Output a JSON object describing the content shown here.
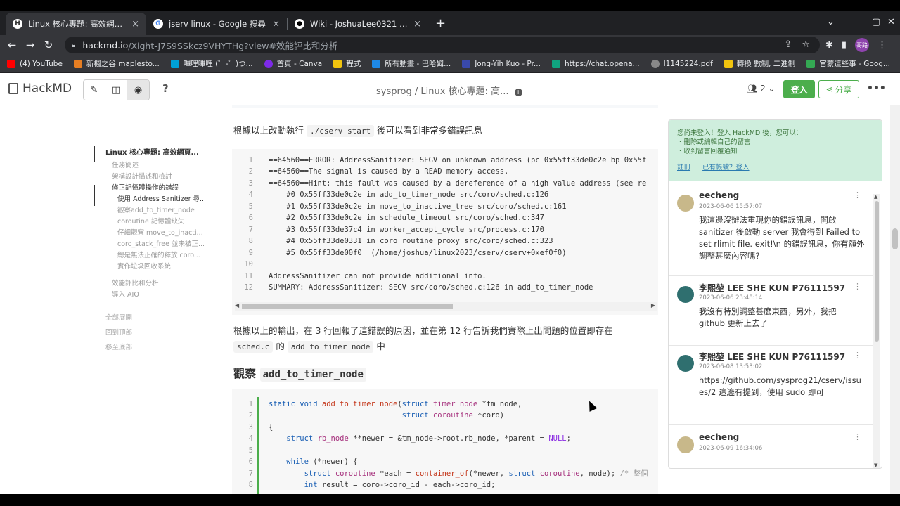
{
  "browser": {
    "tabs": [
      {
        "label": "Linux 核心專題: 高效網頁伺服器",
        "active": true,
        "favicon": "hackmd-icon"
      },
      {
        "label": "jserv linux - Google 搜尋",
        "active": false,
        "favicon": "google-icon"
      },
      {
        "label": "Wiki - JoshuaLee0321 (李熙堃)",
        "active": false,
        "favicon": "github-icon"
      }
    ],
    "new_tab": "+",
    "url_host": "hackmd.io",
    "url_path": "/Xight-J7S9SSkcz9VHYTHg?view#效能評比和分析",
    "profile": "哥路"
  },
  "bookmarks": [
    {
      "label": "(4) YouTube",
      "color": "#ff0000"
    },
    {
      "label": "新楓之谷 maplesto...",
      "color": "#e67e22"
    },
    {
      "label": "嗶哩嗶哩 (゜-゜)つ...",
      "color": "#00a1d6"
    },
    {
      "label": "首頁 - Canva",
      "color": "#7d2ae8"
    },
    {
      "label": "程式",
      "color": "#f1c40f"
    },
    {
      "label": "所有動畫 - 巴哈姆...",
      "color": "#1e88e5"
    },
    {
      "label": "Jong-Yih Kuo - Pr...",
      "color": "#3949ab"
    },
    {
      "label": "https://chat.opena...",
      "color": "#10a37f"
    },
    {
      "label": "I1145224.pdf",
      "color": "#888888"
    },
    {
      "label": "轉換 數制, 二進制",
      "color": "#f1c40f"
    },
    {
      "label": "官蒙這些事 - Goog...",
      "color": "#34a853"
    }
  ],
  "header": {
    "logo": "HackMD",
    "help": "?",
    "doc_title": "sysprog / Linux 核心專題: 高...",
    "users": "2",
    "login": "登入",
    "share": "分享"
  },
  "toc": {
    "title": "Linux 核心專題: 高效網頁...",
    "items": [
      {
        "label": "任務簡述",
        "level": 2
      },
      {
        "label": "架構設計描述和檢討",
        "level": 2
      },
      {
        "label": "修正記憶體操作的錯誤",
        "level": 2,
        "active": true
      },
      {
        "label": "使用 Address Sanitizer 尋...",
        "level": 3,
        "active": true
      },
      {
        "label": "觀察add_to_timer_node",
        "level": 3
      },
      {
        "label": "coroutine 記憶體缺失",
        "level": 3
      },
      {
        "label": "仔細觀察 move_to_inacti...",
        "level": 3
      },
      {
        "label": "coro_stack_free 並未被正...",
        "level": 3
      },
      {
        "label": "總是無法正確的釋放 coro...",
        "level": 3
      },
      {
        "label": "實作垃圾回收系統",
        "level": 3
      },
      {
        "label": "效能評比和分析",
        "level": 2
      },
      {
        "label": "導入 AIO",
        "level": 2
      }
    ],
    "footer": [
      "全部展開",
      "回到頂部",
      "移至底部"
    ]
  },
  "content": {
    "para1_prefix": "根據以上改動執行",
    "para1_code": "./cserv start",
    "para1_suffix": "後可以看到非常多錯誤訊息",
    "asan_lines": [
      {
        "n": "1",
        "t": "==64560==ERROR: AddressSanitizer: SEGV on unknown address (pc 0x55ff33de0c2e bp 0x55f"
      },
      {
        "n": "2",
        "t": "==64560==The signal is caused by a READ memory access."
      },
      {
        "n": "3",
        "t": "==64560==Hint: this fault was caused by a dereference of a high value address (see re"
      },
      {
        "n": "4",
        "t": "    #0 0x55ff33de0c2e in add_to_timer_node src/coro/sched.c:126"
      },
      {
        "n": "5",
        "t": "    #1 0x55ff33de0c2e in move_to_inactive_tree src/coro/sched.c:161"
      },
      {
        "n": "6",
        "t": "    #2 0x55ff33de0c2e in schedule_timeout src/coro/sched.c:347"
      },
      {
        "n": "7",
        "t": "    #3 0x55ff33de37c4 in worker_accept_cycle src/process.c:170"
      },
      {
        "n": "8",
        "t": "    #4 0x55ff33de0331 in coro_routine_proxy src/coro/sched.c:323"
      },
      {
        "n": "9",
        "t": "    #5 0x55ff33de00f0  (/home/joshua/linux2023/cserv/cserv+0xef0f0)"
      },
      {
        "n": "10",
        "t": ""
      },
      {
        "n": "11",
        "t": "AddressSanitizer can not provide additional info."
      },
      {
        "n": "12",
        "t": "SUMMARY: AddressSanitizer: SEGV src/coro/sched.c:126 in add_to_timer_node"
      }
    ],
    "para2_line1": "根據以上的輸出，在 3 行回報了這錯誤的原因，並在第 12 行告訴我們實際上出問題的位置即存在",
    "para2_code1": "sched.c",
    "para2_mid": "的",
    "para2_code2": "add_to_timer_node",
    "para2_end": "中",
    "heading_prefix": "觀察",
    "heading_code": "add_to_timer_node",
    "code2_lines": [
      {
        "n": "1",
        "t": "static void add_to_timer_node(struct timer_node *tm_node,"
      },
      {
        "n": "2",
        "t": "                              struct coroutine *coro)"
      },
      {
        "n": "3",
        "t": "{"
      },
      {
        "n": "4",
        "t": "    struct rb_node **newer = &tm_node->root.rb_node, *parent = NULL;"
      },
      {
        "n": "5",
        "t": ""
      },
      {
        "n": "6",
        "t": "    while (*newer) {"
      },
      {
        "n": "7",
        "t": "        struct coroutine *each = container_of(*newer, struct coroutine, node); /* 整個"
      },
      {
        "n": "8",
        "t": "        int result = coro->coro_id - each->coro_id;"
      }
    ]
  },
  "comments": {
    "notice_line1": "您尚未登入！登入 HackMD 後，您可以：",
    "notice_line2": "・刪除或編輯自己的留言",
    "notice_line3": "・收到留言回覆通知",
    "link_register": "註冊",
    "link_login": "已有帳號？登入",
    "items": [
      {
        "name": "eecheng",
        "date": "2023-06-06 15:57:07",
        "body": "我這邊沒辦法重現你的錯誤訊息，開啟 sanitizer 後啟動 server 我會得到 Failed to set rlimit file. exit!\\n 的錯誤訊息，你有額外調整甚麼內容嗎?",
        "avatar": "#c8b88a"
      },
      {
        "name": "李熙堃 LEE SHE KUN P76111597",
        "date": "2023-06-06 23:48:14",
        "body": "我沒有特別調整甚麼東西，另外，我把 github 更新上去了",
        "avatar": "#2f6f6f"
      },
      {
        "name": "李熙堃 LEE SHE KUN P76111597",
        "date": "2023-06-08 13:53:02",
        "body": "https://github.com/sysprog21/cserv/issues/2 這邊有提到，使用 sudo 即可",
        "avatar": "#2f6f6f"
      },
      {
        "name": "eecheng",
        "date": "2023-06-09 16:34:06",
        "body": "",
        "avatar": "#c8b88a"
      }
    ]
  }
}
